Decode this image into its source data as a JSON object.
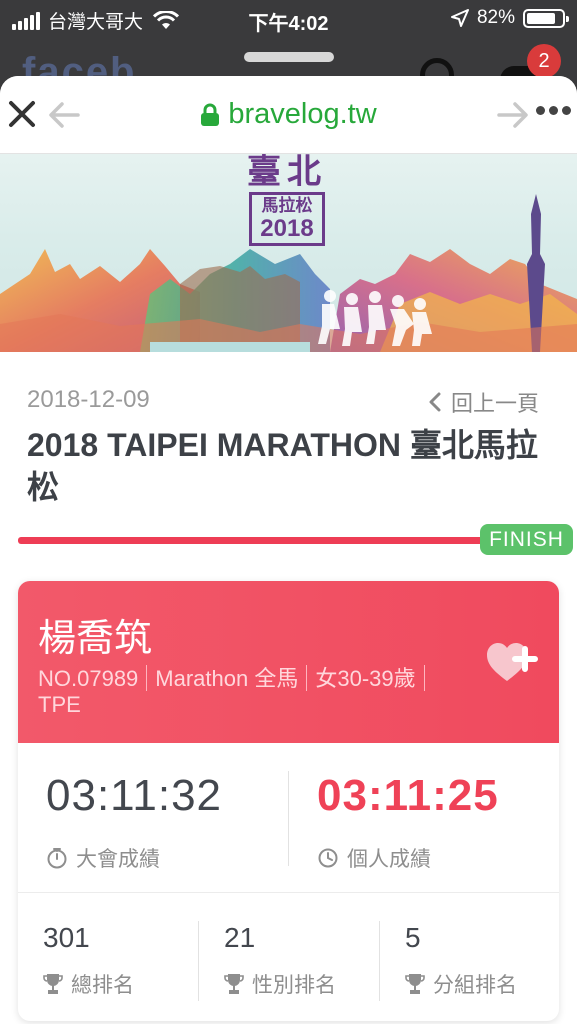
{
  "status_bar": {
    "carrier": "台灣大哥大",
    "time": "下午4:02",
    "battery": "82%",
    "battery_level": 0.82
  },
  "background_app": {
    "logo_text": "faceb",
    "notification_count": "2"
  },
  "browser": {
    "url": "bravelog.tw",
    "icons": [
      "close-icon",
      "back-arrow-icon",
      "lock-icon",
      "forward-arrow-icon",
      "more-icon"
    ]
  },
  "banner": {
    "logo_top": "臺北",
    "logo_sub": "馬拉松",
    "logo_year": "2018"
  },
  "event": {
    "date": "2018-12-09",
    "back_label": "回上一頁",
    "title": "2018 TAIPEI MARATHON 臺北馬拉松",
    "finish_label": "FINISH",
    "progress": 1.0
  },
  "runner": {
    "name": "楊喬筑",
    "bib": "NO.07989",
    "category": "Marathon 全馬",
    "age_group": "女30-39歲",
    "country": "TPE"
  },
  "times": {
    "gun_time": "03:11:32",
    "gun_label": "大會成績",
    "net_time": "03:11:25",
    "net_label": "個人成績"
  },
  "ranks": [
    {
      "value": "301",
      "label": "總排名"
    },
    {
      "value": "21",
      "label": "性別排名"
    },
    {
      "value": "5",
      "label": "分組排名"
    }
  ],
  "colors": {
    "accent_red": "#ef4257",
    "finish_green": "#5cc26a",
    "url_green": "#27a83a"
  }
}
